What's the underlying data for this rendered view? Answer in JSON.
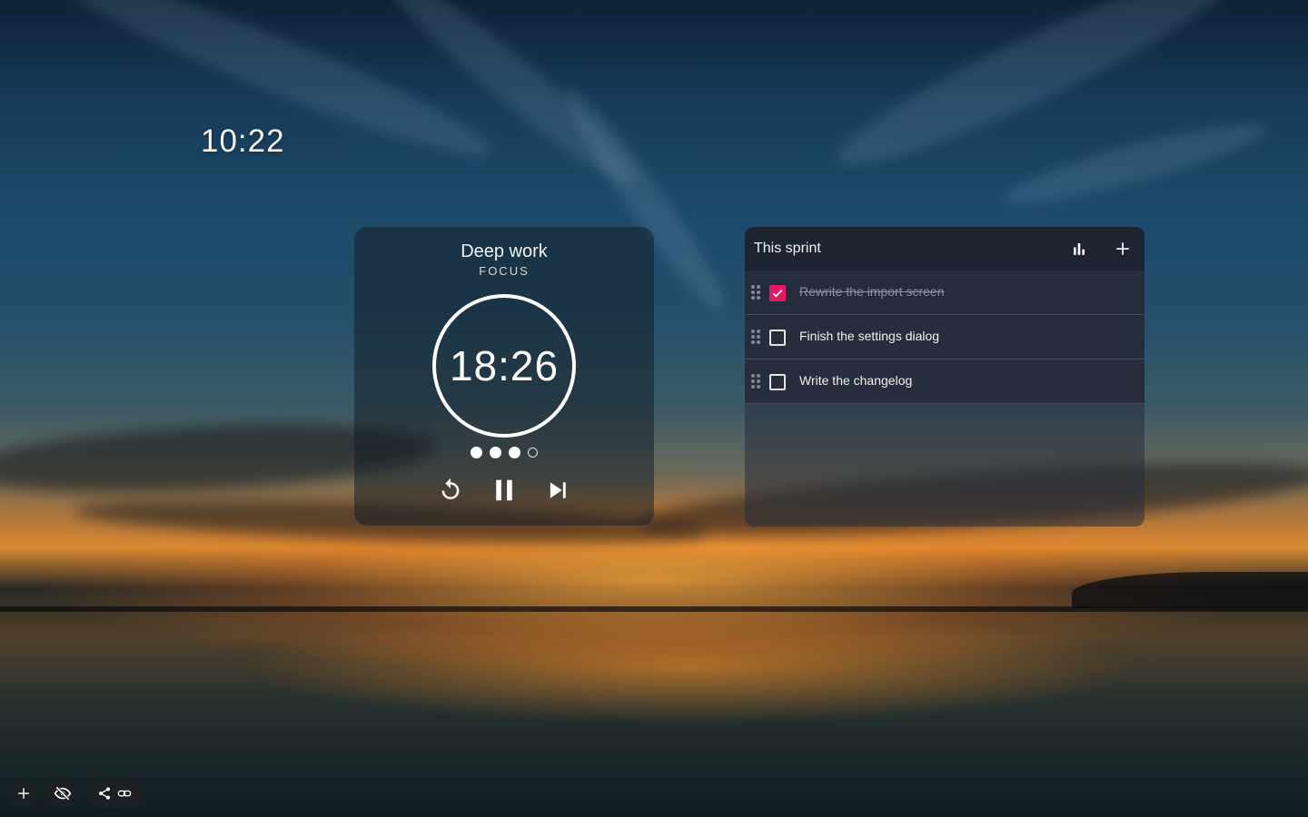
{
  "clock": {
    "time": "10:22"
  },
  "timer": {
    "title": "Deep work",
    "mode": "FOCUS",
    "remaining": "18:26",
    "sessions_completed": 3,
    "sessions_total": 4,
    "state": "running",
    "controls": [
      "reset-icon",
      "pause-icon",
      "skip-next-icon"
    ]
  },
  "tasks": {
    "title": "This sprint",
    "header_icons": [
      "bar-chart-icon",
      "plus-icon"
    ],
    "accent_color": "#e5195f",
    "items": [
      {
        "label": "Rewrite the import screen",
        "done": true
      },
      {
        "label": "Finish the settings dialog",
        "done": false
      },
      {
        "label": "Write the changelog",
        "done": false
      }
    ]
  },
  "toolbar": {
    "buttons": [
      "plus-icon",
      "hide-eye-icon",
      "share-icon",
      "link-icon"
    ]
  }
}
